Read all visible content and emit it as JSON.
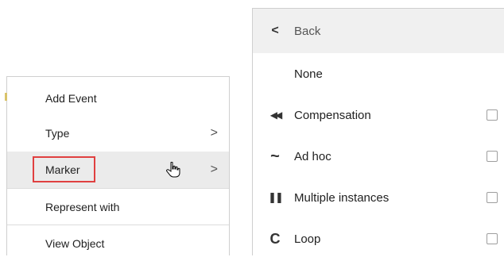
{
  "left_menu": {
    "items": [
      {
        "label": "Add Event",
        "has_submenu": false
      },
      {
        "label": "Type",
        "has_submenu": true
      },
      {
        "label": "Marker",
        "has_submenu": true,
        "highlighted": true
      },
      {
        "label": "Represent with",
        "has_submenu": false
      },
      {
        "label": "View Object",
        "has_submenu": false
      }
    ],
    "chevron": ">"
  },
  "right_menu": {
    "back": {
      "label": "Back",
      "icon": "chevron-left-icon",
      "glyph": "<"
    },
    "items": [
      {
        "label": "None",
        "icon": null,
        "glyph": "",
        "checkbox": false
      },
      {
        "label": "Compensation",
        "icon": "rewind-icon",
        "glyph": "◀◀",
        "checkbox": true,
        "checked": false
      },
      {
        "label": "Ad hoc",
        "icon": "tilde-icon",
        "glyph": "~",
        "checkbox": true,
        "checked": false
      },
      {
        "label": "Multiple instances",
        "icon": "parallel-bars-icon",
        "glyph": "❚❚",
        "checkbox": true,
        "checked": false
      },
      {
        "label": "Loop",
        "icon": "loop-icon",
        "glyph": "C",
        "checkbox": true,
        "checked": false
      }
    ]
  },
  "colors": {
    "highlight": "#ebebeb",
    "annotation_box": "#e04040",
    "back_row": "#f0f0f0"
  }
}
